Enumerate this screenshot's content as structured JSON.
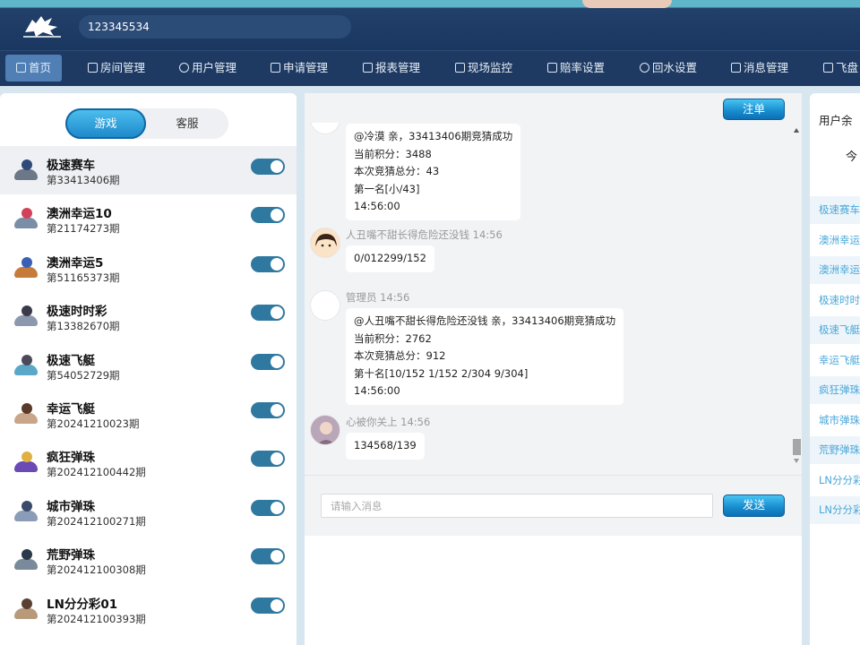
{
  "header": {
    "account": "123345534"
  },
  "nav": [
    {
      "label": "首页",
      "icon": "home-icon"
    },
    {
      "label": "房间管理",
      "icon": "room-icon"
    },
    {
      "label": "用户管理",
      "icon": "user-icon"
    },
    {
      "label": "申请管理",
      "icon": "apply-icon"
    },
    {
      "label": "报表管理",
      "icon": "report-icon"
    },
    {
      "label": "现场监控",
      "icon": "monitor-icon"
    },
    {
      "label": "赔率设置",
      "icon": "odds-icon"
    },
    {
      "label": "回水设置",
      "icon": "rebate-icon"
    },
    {
      "label": "消息管理",
      "icon": "message-icon"
    },
    {
      "label": "飞盘",
      "icon": "flyplate-icon"
    }
  ],
  "left_tabs": {
    "game": "游戏",
    "service": "客服"
  },
  "games": [
    {
      "name": "极速赛车",
      "period": "第33413406期",
      "enabled": true
    },
    {
      "name": "澳洲幸运10",
      "period": "第21174273期",
      "enabled": true
    },
    {
      "name": "澳洲幸运5",
      "period": "第51165373期",
      "enabled": true
    },
    {
      "name": "极速时时彩",
      "period": "第13382670期",
      "enabled": true
    },
    {
      "name": "极速飞艇",
      "period": "第54052729期",
      "enabled": true
    },
    {
      "name": "幸运飞艇",
      "period": "第20241210023期",
      "enabled": true
    },
    {
      "name": "疯狂弹珠",
      "period": "第202412100442期",
      "enabled": true
    },
    {
      "name": "城市弹珠",
      "period": "第202412100271期",
      "enabled": true
    },
    {
      "name": "荒野弹珠",
      "period": "第202412100308期",
      "enabled": true
    },
    {
      "name": "LN分分彩01",
      "period": "第202412100393期",
      "enabled": true
    }
  ],
  "chat": {
    "cancel_button": "注单",
    "send_button": "发送",
    "input_placeholder": "请输入消息",
    "messages": [
      {
        "meta": "",
        "lines": [
          "@冷漠 亲，33413406期竞猜成功",
          "当前积分：3488",
          "本次竞猜总分：43",
          "第一名[小/43]",
          "14:56:00"
        ]
      },
      {
        "meta": "人丑嘴不甜长得危险还没钱 14:56",
        "lines": [
          "0/012299/152"
        ]
      },
      {
        "meta": "管理员 14:56",
        "lines": [
          "@人丑嘴不甜长得危险还没钱 亲，33413406期竞猜成功",
          "当前积分：2762",
          "本次竞猜总分：912",
          "第十名[10/152 1/152 2/304 9/304]",
          "14:56:00"
        ]
      },
      {
        "meta": "心被你关上 14:56",
        "lines": [
          "134568/139"
        ]
      }
    ]
  },
  "right_panel": {
    "title": "用户余",
    "sub": "今",
    "items": [
      "极速赛车",
      "澳洲幸运",
      "澳洲幸运",
      "极速时时",
      "极速飞艇",
      "幸运飞艇",
      "疯狂弹珠",
      "城市弹珠",
      "荒野弹珠",
      "LN分分彩",
      "LN分分彩"
    ]
  },
  "colors": {
    "header_bg": "#1a3760",
    "accent_blue": "#1a8fd0",
    "toggle_on": "#2f78a0",
    "link_blue": "#4aa7d8"
  }
}
